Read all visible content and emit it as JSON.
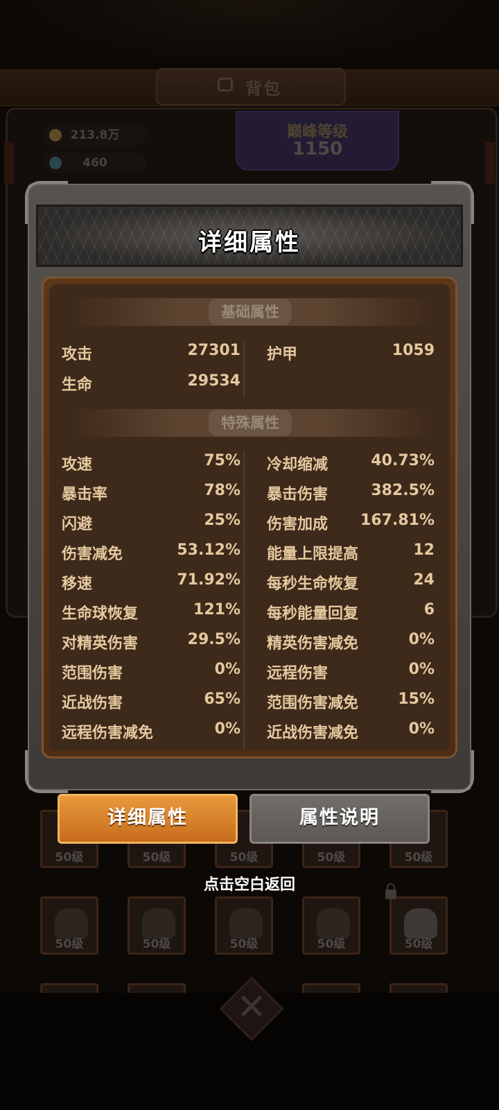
{
  "background": {
    "header_title": "背包",
    "gold": "213.8万",
    "gems": "460",
    "level_label": "巅峰等级",
    "level_value": "1150",
    "slot_level_label": "50级"
  },
  "panel": {
    "title": "详细属性",
    "sections": {
      "basic": "基础属性",
      "special": "特殊属性"
    },
    "basic_stats": [
      {
        "left_name": "攻击",
        "left_value": "27301",
        "right_name": "护甲",
        "right_value": "1059"
      },
      {
        "left_name": "生命",
        "left_value": "29534",
        "right_name": "",
        "right_value": ""
      }
    ],
    "special_stats": [
      {
        "left_name": "攻速",
        "left_value": "75%",
        "right_name": "冷却缩减",
        "right_value": "40.73%"
      },
      {
        "left_name": "暴击率",
        "left_value": "78%",
        "right_name": "暴击伤害",
        "right_value": "382.5%"
      },
      {
        "left_name": "闪避",
        "left_value": "25%",
        "right_name": "伤害加成",
        "right_value": "167.81%"
      },
      {
        "left_name": "伤害减免",
        "left_value": "53.12%",
        "right_name": "能量上限提高",
        "right_value": "12"
      },
      {
        "left_name": "移速",
        "left_value": "71.92%",
        "right_name": "每秒生命恢复",
        "right_value": "24"
      },
      {
        "left_name": "生命球恢复",
        "left_value": "121%",
        "right_name": "每秒能量回复",
        "right_value": "6"
      },
      {
        "left_name": "对精英伤害",
        "left_value": "29.5%",
        "right_name": "精英伤害减免",
        "right_value": "0%"
      },
      {
        "left_name": "范围伤害",
        "left_value": "0%",
        "right_name": "远程伤害",
        "right_value": "0%"
      },
      {
        "left_name": "近战伤害",
        "left_value": "65%",
        "right_name": "范围伤害减免",
        "right_value": "15%"
      },
      {
        "left_name": "远程伤害减免",
        "left_value": "0%",
        "right_name": "近战伤害减免",
        "right_value": "0%"
      }
    ]
  },
  "tabs": {
    "detail": "详细属性",
    "explain": "属性说明"
  },
  "hint": "点击空白返回",
  "colors": {
    "stat_text": "#e5c99f",
    "tab_active": "#e89a3c",
    "tab_inactive": "#716d69"
  }
}
